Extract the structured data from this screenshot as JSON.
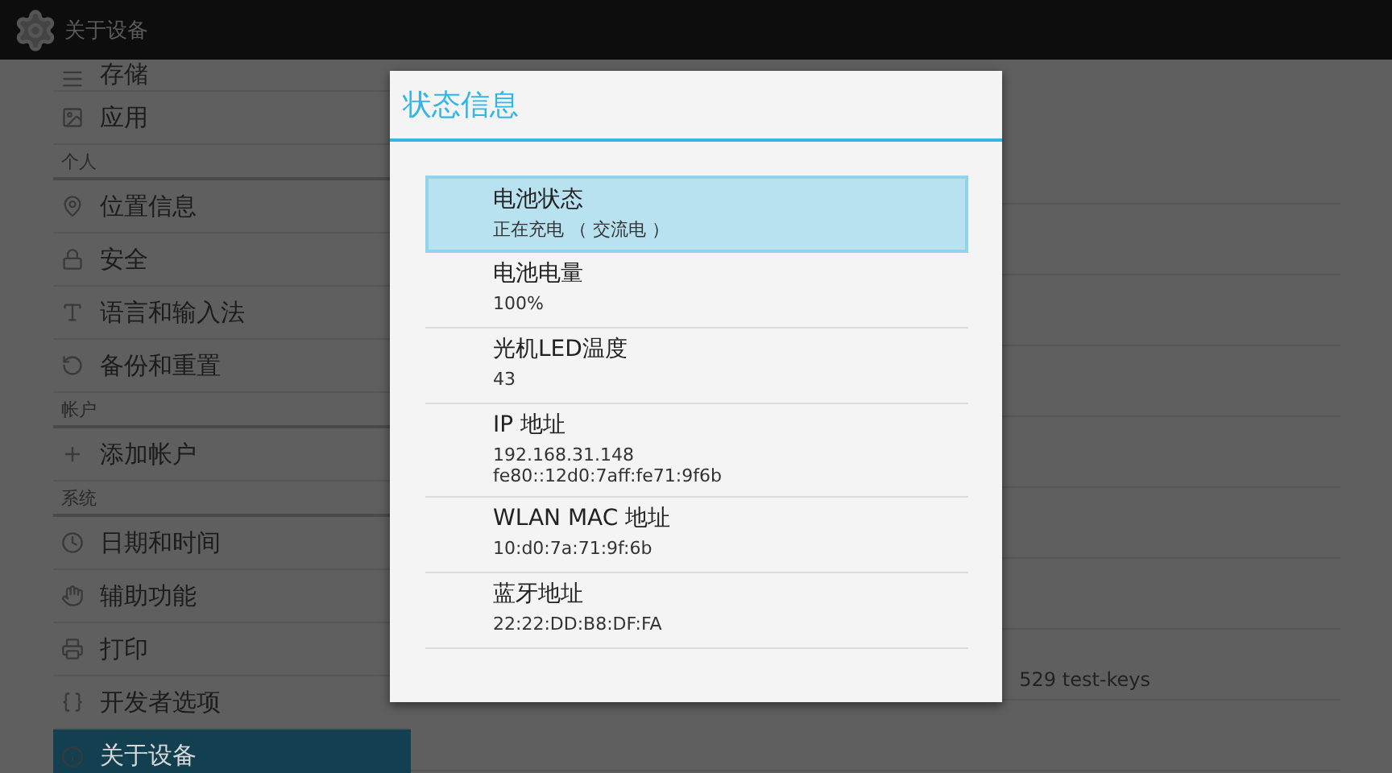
{
  "action_bar": {
    "title": "关于设备"
  },
  "sidebar": {
    "items": [
      {
        "kind": "item",
        "label": "存储",
        "selected": false
      },
      {
        "kind": "item",
        "label": "应用",
        "selected": false
      },
      {
        "kind": "header",
        "label": "个人"
      },
      {
        "kind": "item",
        "label": "位置信息",
        "selected": false
      },
      {
        "kind": "item",
        "label": "安全",
        "selected": false
      },
      {
        "kind": "item",
        "label": "语言和输入法",
        "selected": false
      },
      {
        "kind": "item",
        "label": "备份和重置",
        "selected": false
      },
      {
        "kind": "header",
        "label": "帐户"
      },
      {
        "kind": "item",
        "label": "添加帐户",
        "selected": false
      },
      {
        "kind": "header",
        "label": "系统"
      },
      {
        "kind": "item",
        "label": "日期和时间",
        "selected": false
      },
      {
        "kind": "item",
        "label": "辅助功能",
        "selected": false
      },
      {
        "kind": "item",
        "label": "打印",
        "selected": false
      },
      {
        "kind": "item",
        "label": "开发者选项",
        "selected": false
      },
      {
        "kind": "item",
        "label": "关于设备",
        "selected": true
      }
    ]
  },
  "detail_pane": {
    "text": "529 test-keys"
  },
  "dialog": {
    "title": "状态信息",
    "rows": [
      {
        "title": "电池状态",
        "value": "正在充电 （ 交流电 ）",
        "selected": true
      },
      {
        "title": "电池电量",
        "value": "100%",
        "selected": false
      },
      {
        "title": "光机LED温度",
        "value": "43",
        "selected": false
      },
      {
        "title": "IP 地址",
        "value": "192.168.31.148\nfe80::12d0:7aff:fe71:9f6b",
        "selected": false
      },
      {
        "title": "WLAN MAC 地址",
        "value": "10:d0:7a:71:9f:6b",
        "selected": false
      },
      {
        "title": "蓝牙地址",
        "value": "22:22:DD:B8:DF:FA",
        "selected": false
      }
    ]
  }
}
